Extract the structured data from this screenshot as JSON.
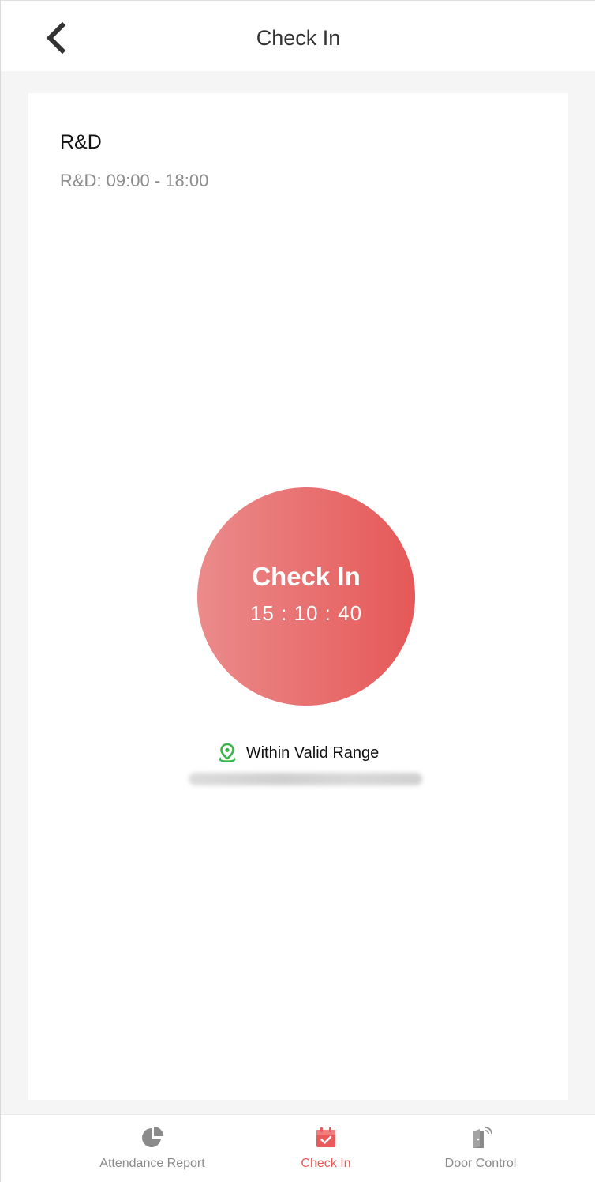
{
  "header": {
    "title": "Check In",
    "back_icon": "chevron-left-icon"
  },
  "card": {
    "department": "R&D",
    "shift": "R&D: 09:00 - 18:00"
  },
  "checkin": {
    "label": "Check In",
    "time": "15 : 10 : 40",
    "colors": {
      "start": "#eb8b8b",
      "end": "#e65858"
    }
  },
  "location": {
    "icon": "location-pin-icon",
    "status": "Within Valid Range",
    "status_color": "#3ab54a"
  },
  "tabbar": {
    "active_color": "#e95b5b",
    "items": [
      {
        "label": "Attendance Report",
        "icon": "pie-chart-icon",
        "active": false
      },
      {
        "label": "Check In",
        "icon": "calendar-check-icon",
        "active": true
      },
      {
        "label": "Door Control",
        "icon": "door-wireless-icon",
        "active": false
      }
    ]
  }
}
